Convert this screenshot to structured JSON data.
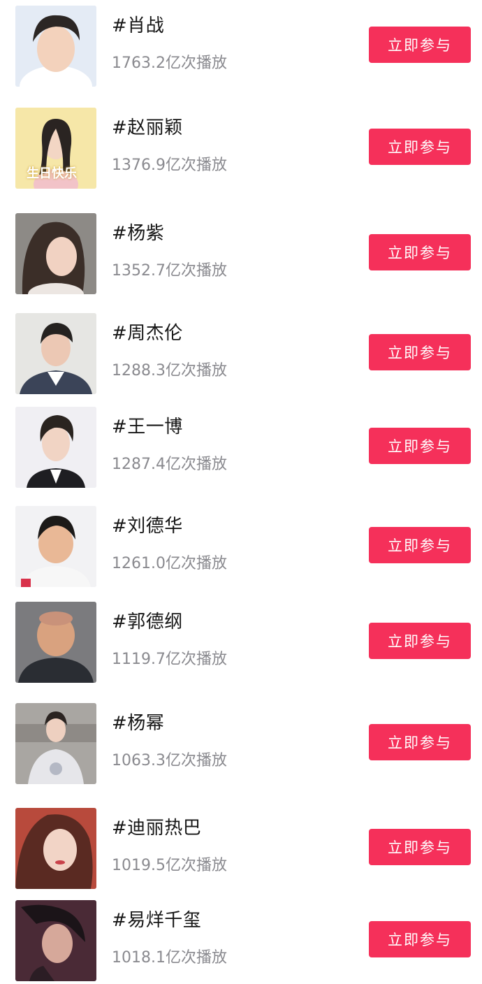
{
  "topics": [
    {
      "title": "#肖战",
      "plays": "1763.2亿次播放",
      "button": "立即参与"
    },
    {
      "title": "#赵丽颖",
      "plays": "1376.9亿次播放",
      "button": "立即参与",
      "thumb_text": "生日快乐"
    },
    {
      "title": "#杨紫",
      "plays": "1352.7亿次播放",
      "button": "立即参与"
    },
    {
      "title": "#周杰伦",
      "plays": "1288.3亿次播放",
      "button": "立即参与"
    },
    {
      "title": "#王一博",
      "plays": "1287.4亿次播放",
      "button": "立即参与"
    },
    {
      "title": "#刘德华",
      "plays": "1261.0亿次播放",
      "button": "立即参与"
    },
    {
      "title": "#郭德纲",
      "plays": "1119.7亿次播放",
      "button": "立即参与"
    },
    {
      "title": "#杨幂",
      "plays": "1063.3亿次播放",
      "button": "立即参与"
    },
    {
      "title": "#迪丽热巴",
      "plays": "1019.5亿次播放",
      "button": "立即参与"
    },
    {
      "title": "#易烊千玺",
      "plays": "1018.1亿次播放",
      "button": "立即参与"
    }
  ],
  "colors": {
    "button_bg": "#f5305a",
    "title": "#161616",
    "plays": "#8a8a8f"
  }
}
